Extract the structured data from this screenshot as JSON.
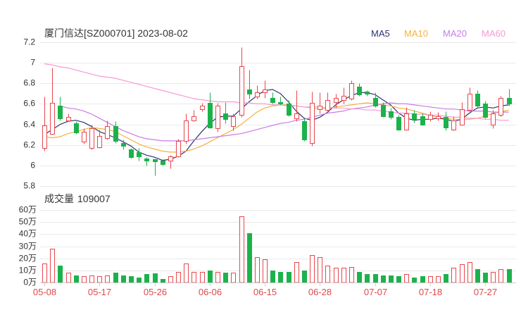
{
  "chart_data": [
    {
      "type": "candlestick",
      "title": "厦门信达[SZ000701] 2023-08-02",
      "legend": "top-right",
      "grid": true,
      "ylim": [
        5.8,
        7.2
      ],
      "y_ticks": [
        "7.2",
        "7",
        "6.8",
        "6.6",
        "6.4",
        "6.2",
        "6",
        "5.8"
      ],
      "x_ticks": [
        "05-08",
        "05-17",
        "05-26",
        "06-06",
        "06-15",
        "06-28",
        "07-07",
        "07-18",
        "07-27"
      ],
      "x": [
        "05-08",
        "05-09",
        "05-10",
        "05-11",
        "05-12",
        "05-15",
        "05-16",
        "05-17",
        "05-18",
        "05-19",
        "05-22",
        "05-23",
        "05-24",
        "05-25",
        "05-26",
        "05-29",
        "05-30",
        "05-31",
        "06-01",
        "06-02",
        "06-05",
        "06-06",
        "06-07",
        "06-08",
        "06-09",
        "06-12",
        "06-13",
        "06-14",
        "06-15",
        "06-16",
        "06-19",
        "06-20",
        "06-21",
        "06-26",
        "06-27",
        "06-28",
        "06-29",
        "06-30",
        "07-03",
        "07-04",
        "07-05",
        "07-06",
        "07-07",
        "07-10",
        "07-11",
        "07-12",
        "07-13",
        "07-14",
        "07-17",
        "07-18",
        "07-19",
        "07-20",
        "07-21",
        "07-24",
        "07-25",
        "07-26",
        "07-27",
        "07-28",
        "07-31",
        "08-01"
      ],
      "open": [
        6.17,
        6.31,
        6.58,
        6.44,
        6.41,
        6.23,
        6.17,
        6.18,
        6.27,
        6.38,
        6.22,
        6.16,
        6.13,
        6.07,
        6.06,
        6.05,
        6.05,
        6.09,
        6.24,
        6.44,
        6.55,
        6.61,
        6.36,
        6.51,
        6.38,
        6.49,
        6.74,
        6.67,
        6.71,
        6.66,
        6.62,
        6.6,
        6.46,
        6.43,
        6.22,
        6.55,
        6.54,
        6.62,
        6.64,
        6.65,
        6.77,
        6.72,
        6.66,
        6.59,
        6.53,
        6.47,
        6.35,
        6.51,
        6.48,
        6.45,
        6.46,
        6.47,
        6.35,
        6.4,
        6.54,
        6.7,
        6.6,
        6.4,
        6.49,
        6.66
      ],
      "high": [
        6.67,
        6.95,
        6.67,
        6.51,
        6.43,
        6.36,
        6.4,
        6.35,
        6.44,
        6.43,
        6.25,
        6.17,
        6.17,
        6.08,
        6.07,
        6.06,
        6.1,
        6.26,
        6.51,
        6.54,
        6.61,
        6.71,
        6.61,
        6.62,
        6.51,
        7.15,
        6.93,
        6.78,
        6.83,
        6.71,
        6.67,
        6.64,
        6.73,
        6.46,
        6.72,
        6.71,
        6.71,
        6.7,
        6.76,
        6.83,
        6.8,
        6.73,
        6.71,
        6.62,
        6.56,
        6.49,
        6.57,
        6.54,
        6.51,
        6.53,
        6.52,
        6.53,
        6.48,
        6.62,
        6.76,
        6.73,
        6.63,
        6.54,
        6.68,
        6.75
      ],
      "low": [
        6.14,
        6.3,
        6.44,
        6.43,
        6.31,
        6.21,
        6.16,
        6.17,
        6.25,
        6.22,
        6.16,
        6.07,
        6.05,
        6.0,
        5.9,
        6.0,
        5.97,
        6.08,
        6.21,
        6.43,
        6.53,
        6.36,
        6.33,
        6.41,
        6.34,
        6.47,
        6.65,
        6.65,
        6.66,
        6.6,
        6.59,
        6.48,
        6.43,
        6.24,
        6.19,
        6.51,
        6.52,
        6.56,
        6.6,
        6.64,
        6.68,
        6.68,
        6.57,
        6.47,
        6.45,
        6.34,
        6.34,
        6.42,
        6.39,
        6.43,
        6.44,
        6.34,
        6.34,
        6.39,
        6.53,
        6.57,
        6.46,
        6.36,
        6.48,
        6.58
      ],
      "close": [
        6.39,
        6.61,
        6.46,
        6.47,
        6.32,
        6.33,
        6.36,
        6.29,
        6.38,
        6.24,
        6.19,
        6.08,
        6.09,
        6.05,
        6.04,
        6.01,
        6.09,
        6.24,
        6.44,
        6.48,
        6.58,
        6.37,
        6.58,
        6.45,
        6.48,
        6.97,
        6.7,
        6.71,
        6.74,
        6.62,
        6.6,
        6.49,
        6.51,
        6.25,
        6.61,
        6.58,
        6.64,
        6.66,
        6.68,
        6.8,
        6.69,
        6.7,
        6.58,
        6.48,
        6.47,
        6.35,
        6.51,
        6.45,
        6.4,
        6.49,
        6.48,
        6.37,
        6.44,
        6.55,
        6.7,
        6.58,
        6.47,
        6.51,
        6.66,
        6.6
      ],
      "up_color": "#e8474d",
      "down_color": "#1cb24b",
      "series": [
        {
          "name": "MA5",
          "color": "#2c3470",
          "values": [
            6.3,
            6.35,
            6.4,
            6.43,
            6.44,
            6.42,
            6.38,
            6.33,
            6.3,
            6.27,
            6.23,
            6.19,
            6.13,
            6.1,
            6.08,
            6.05,
            6.06,
            6.09,
            6.14,
            6.24,
            6.33,
            6.41,
            6.47,
            6.48,
            6.48,
            6.55,
            6.62,
            6.68,
            6.73,
            6.74,
            6.7,
            6.62,
            6.53,
            6.46,
            6.44,
            6.47,
            6.52,
            6.59,
            6.64,
            6.68,
            6.71,
            6.71,
            6.69,
            6.64,
            6.59,
            6.51,
            6.46,
            6.44,
            6.45,
            6.45,
            6.46,
            6.45,
            6.43,
            6.45,
            6.51,
            6.56,
            6.57,
            6.56,
            6.58,
            6.59
          ]
        },
        {
          "name": "MA10",
          "color": "#f4b23c",
          "values": [
            6.28,
            6.27,
            6.28,
            6.31,
            6.33,
            6.35,
            6.37,
            6.36,
            6.35,
            6.33,
            6.29,
            6.25,
            6.21,
            6.18,
            6.16,
            6.14,
            6.13,
            6.13,
            6.14,
            6.16,
            6.19,
            6.23,
            6.27,
            6.31,
            6.35,
            6.4,
            6.46,
            6.52,
            6.56,
            6.58,
            6.59,
            6.59,
            6.58,
            6.57,
            6.56,
            6.55,
            6.56,
            6.57,
            6.58,
            6.59,
            6.6,
            6.61,
            6.6,
            6.59,
            6.58,
            6.56,
            6.55,
            6.53,
            6.51,
            6.49,
            6.47,
            6.46,
            6.45,
            6.45,
            6.45,
            6.46,
            6.48,
            6.51,
            6.52,
            6.54
          ]
        },
        {
          "name": "MA20",
          "color": "#c97ce6",
          "values": [
            null,
            null,
            6.58,
            6.56,
            6.55,
            6.53,
            6.5,
            6.46,
            6.42,
            6.38,
            6.34,
            6.31,
            6.28,
            6.26,
            6.25,
            6.24,
            6.24,
            6.24,
            6.24,
            6.25,
            6.26,
            6.27,
            6.28,
            6.29,
            6.3,
            6.31,
            6.33,
            6.35,
            6.37,
            6.39,
            6.41,
            6.42,
            6.44,
            6.45,
            6.47,
            6.49,
            6.51,
            6.52,
            6.53,
            6.55,
            6.56,
            6.57,
            6.59,
            6.6,
            6.61,
            6.6,
            6.6,
            6.59,
            6.58,
            6.57,
            6.56,
            6.55,
            6.55,
            6.54,
            6.53,
            6.53,
            6.53,
            6.52,
            6.52,
            6.52
          ]
        },
        {
          "name": "MA60",
          "color": "#f49ad3",
          "values": [
            6.99,
            6.98,
            6.96,
            6.95,
            6.93,
            6.91,
            6.89,
            6.87,
            6.86,
            6.85,
            6.83,
            6.81,
            6.79,
            6.77,
            6.75,
            6.73,
            6.71,
            6.69,
            6.67,
            6.65,
            6.64,
            6.63,
            6.62,
            6.62,
            6.62,
            6.61,
            6.61,
            6.6,
            6.6,
            6.59,
            6.59,
            6.58,
            6.58,
            6.57,
            6.57,
            6.57,
            6.56,
            6.56,
            6.56,
            6.55,
            6.55,
            6.54,
            6.54,
            6.53,
            6.52,
            6.51,
            6.51,
            6.5,
            6.5,
            6.49,
            6.49,
            6.48,
            6.47,
            6.47,
            6.46,
            6.46,
            6.45,
            6.45,
            6.44,
            6.44
          ]
        }
      ]
    },
    {
      "type": "bar",
      "title": "成交量",
      "latest": "109007",
      "ylim": [
        0,
        60
      ],
      "y_ticks": [
        "60万",
        "50万",
        "40万",
        "30万",
        "20万",
        "10万",
        "0万"
      ],
      "values": [
        16,
        28,
        14,
        8,
        6,
        5.5,
        6,
        5,
        6,
        8,
        6,
        5,
        4,
        7,
        7.5,
        3,
        5,
        9,
        16,
        9,
        9,
        10,
        9,
        8,
        8,
        55,
        41,
        21,
        19,
        10,
        9,
        9,
        17,
        10,
        23,
        21,
        14,
        12,
        12,
        13,
        9,
        7,
        7,
        6,
        6,
        5,
        7,
        4,
        5,
        5,
        5.5,
        7,
        12,
        15,
        17,
        11,
        8,
        9,
        11,
        10.9
      ]
    }
  ]
}
